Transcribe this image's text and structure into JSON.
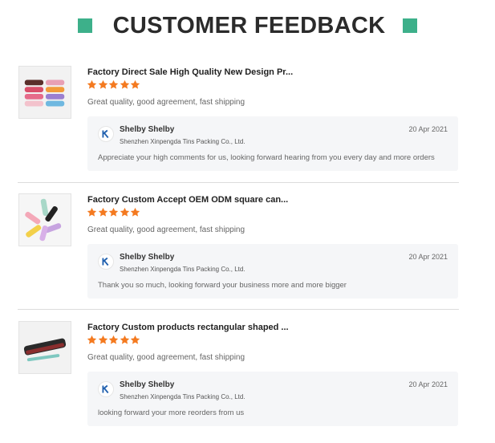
{
  "header": {
    "title": "CUSTOMER FEEDBACK",
    "accent_color": "#3db08a"
  },
  "star_color": "#f47a20",
  "reviews": [
    {
      "product_title": "Factory Direct Sale High Quality New Design Pr...",
      "rating": 5,
      "comment": "Great quality, good agreement, fast shipping",
      "image_icon": "colorful-pencil-cases-image",
      "reply": {
        "name": "Shelby Shelby",
        "company": "Shenzhen Xinpengda Tins Packing Co., Ltd.",
        "date": "20 Apr 2021",
        "text": "Appreciate your high comments for us, looking forward hearing from you every day and more orders"
      }
    },
    {
      "product_title": "Factory Custom Accept OEM ODM square can...",
      "rating": 5,
      "comment": "Great quality, good agreement, fast shipping",
      "image_icon": "pastel-tins-fan-image",
      "reply": {
        "name": "Shelby Shelby",
        "company": "Shenzhen Xinpengda Tins Packing Co., Ltd.",
        "date": "20 Apr 2021",
        "text": "Thank you so much, looking forward your business more and more bigger"
      }
    },
    {
      "product_title": "Factory Custom products rectangular shaped ...",
      "rating": 5,
      "comment": "Great quality, good agreement, fast shipping",
      "image_icon": "dark-pencil-tin-image",
      "reply": {
        "name": "Shelby Shelby",
        "company": "Shenzhen Xinpengda Tins Packing Co., Ltd.",
        "date": "20 Apr 2021",
        "text": "looking forward your more reorders from us"
      }
    }
  ]
}
